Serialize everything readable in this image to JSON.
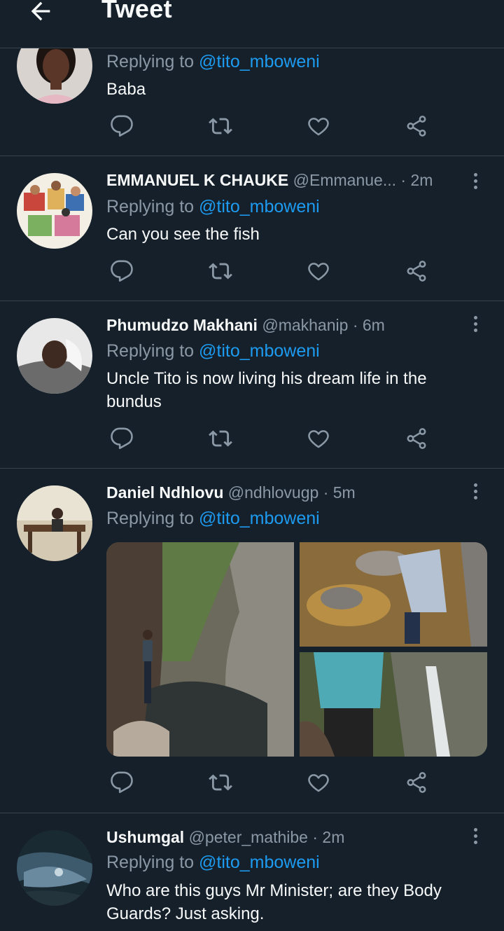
{
  "header": {
    "title": "Tweet",
    "back_icon": "arrow-left-icon"
  },
  "colors": {
    "background": "#15202b",
    "divider": "#38444d",
    "muted": "#8b98a5",
    "link": "#1d9bf0",
    "text": "#f7f9f9"
  },
  "replying_prefix": "Replying to",
  "tweets": [
    {
      "name": "",
      "handle": "",
      "dot": "",
      "time": "",
      "replying_to": "@tito_mboweni",
      "text": "Baba"
    },
    {
      "name": "EMMANUEL K CHAUKE",
      "handle": "@Emmanue...",
      "dot": "·",
      "time": "2m",
      "replying_to": "@tito_mboweni",
      "text": "Can you see the fish"
    },
    {
      "name": "Phumudzo Makhani",
      "handle": "@makhanip",
      "dot": "·",
      "time": "6m",
      "replying_to": "@tito_mboweni",
      "text": "Uncle Tito is now living his dream life in the bundus"
    },
    {
      "name": "Daniel Ndhlovu",
      "handle": "@ndhlovugp",
      "dot": "·",
      "time": "5m",
      "replying_to": "@tito_mboweni",
      "text": ""
    },
    {
      "name": "Ushumgal",
      "handle": "@peter_mathibe",
      "dot": "·",
      "time": "2m",
      "replying_to": "@tito_mboweni",
      "text": "Who are this guys Mr Minister; are they Body Guards? Just asking."
    }
  ],
  "action_icons": [
    "reply-icon",
    "retweet-icon",
    "like-icon",
    "share-icon"
  ]
}
